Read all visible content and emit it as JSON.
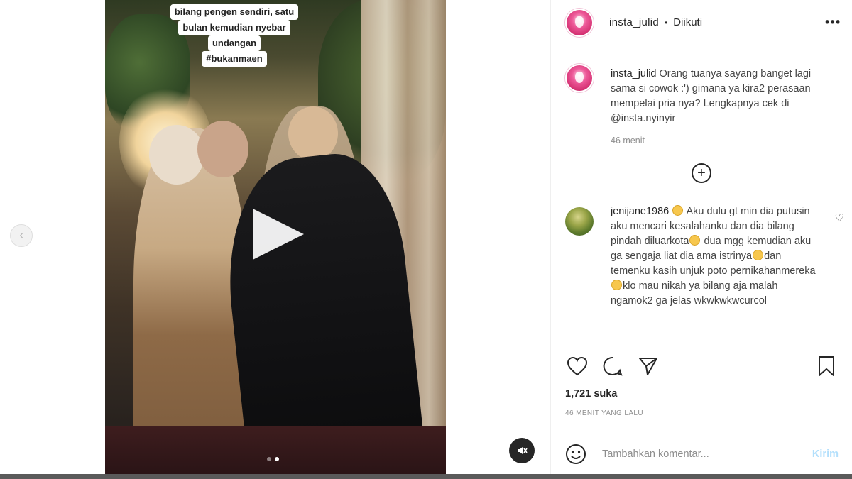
{
  "video": {
    "caption_lines": [
      "bilang pengen sendiri, satu",
      "bulan kemudian nyebar",
      "undangan",
      "#bukanmaen"
    ],
    "carousel_dots": 2,
    "active_dot": 2
  },
  "header": {
    "username": "insta_julid",
    "separator": "•",
    "follow_status": "Diikuti",
    "more": "•••"
  },
  "caption": {
    "username": "insta_julid",
    "text": "Orang tuanya sayang banget lagi sama si cowok :') gimana ya kira2 perasaan mempelai pria nya? Lengkapnya cek di @insta.nyinyir",
    "time": "46 menit"
  },
  "more_comments_icon": "plus-circle-icon",
  "comment": {
    "username": "jenijane1986",
    "parts": [
      {
        "text": ""
      },
      {
        "emoji": "astonished-face"
      },
      {
        "text": " Aku dulu gt min dia putusin aku mencari kesalahanku dan dia bilang pindah diluarkota"
      },
      {
        "emoji": "astonished-face"
      },
      {
        "text": " dua mgg kemudian aku ga sengaja liat dia ama istrinya"
      },
      {
        "emoji": "grinning-face"
      },
      {
        "text": "dan temenku kasih unjuk poto pernikahanmereka"
      },
      {
        "emoji": "grinning-face"
      },
      {
        "text": "klo mau nikah ya bilang aja malah ngamok2 ga jelas wkwkwkwcurcol"
      }
    ]
  },
  "actions": {
    "icons": [
      "heart-icon",
      "comment-icon",
      "share-icon",
      "bookmark-icon"
    ]
  },
  "likes": "1,721 suka",
  "posted": "46 MENIT YANG LALU",
  "add_comment": {
    "placeholder": "Tambahkan komentar...",
    "post_label": "Kirim"
  },
  "colors": {
    "text": "#262626",
    "muted": "#8e8e8e",
    "post_disabled": "#b2dffc",
    "divider": "#efefef"
  }
}
